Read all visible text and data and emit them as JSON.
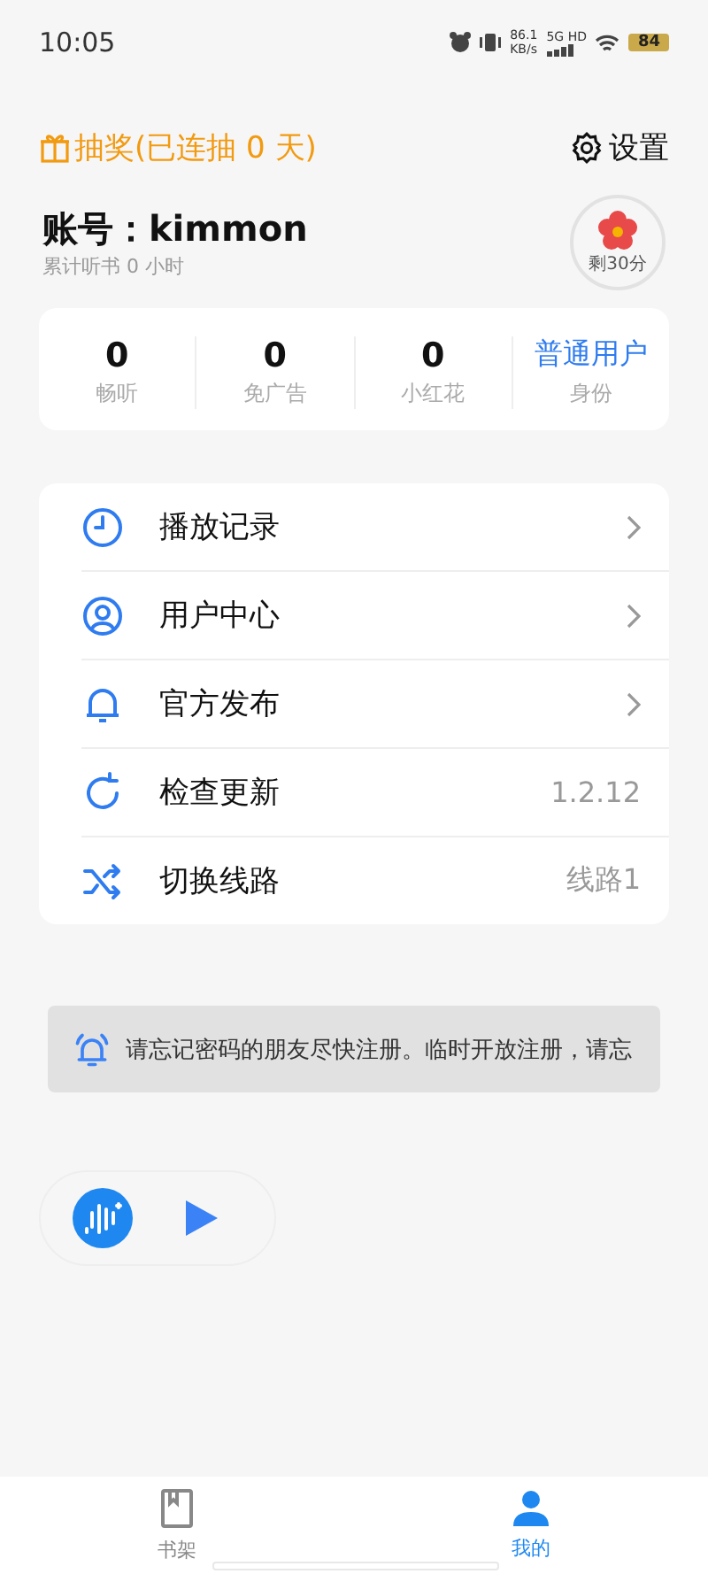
{
  "status_bar": {
    "time": "10:05",
    "speed": "86.1",
    "speed_unit": "KB/s",
    "network": "5G",
    "network_extra": "HD",
    "battery": "84"
  },
  "header": {
    "lottery": "抽奖(已连抽 0 天)",
    "settings": "设置"
  },
  "account": {
    "title": "账号：kimmon",
    "subtitle": "累计听书 0 小时",
    "timer": "剩30分"
  },
  "stats": [
    {
      "value": "0",
      "label": "畅听",
      "kind": "number"
    },
    {
      "value": "0",
      "label": "免广告",
      "kind": "number"
    },
    {
      "value": "0",
      "label": "小红花",
      "kind": "number"
    },
    {
      "value": "普通用户",
      "label": "身份",
      "kind": "role"
    }
  ],
  "menu": [
    {
      "label": "播放记录",
      "kind": "link"
    },
    {
      "label": "用户中心",
      "kind": "link"
    },
    {
      "label": "官方发布",
      "kind": "link"
    },
    {
      "label": "检查更新",
      "kind": "value",
      "value": "1.2.12"
    },
    {
      "label": "切换线路",
      "kind": "value",
      "value": "线路1"
    }
  ],
  "notice": "请忘记密码的朋友尽快注册。临时开放注册，请忘",
  "tabs": [
    {
      "label": "书架",
      "selected": false
    },
    {
      "label": "我的",
      "selected": true
    }
  ]
}
